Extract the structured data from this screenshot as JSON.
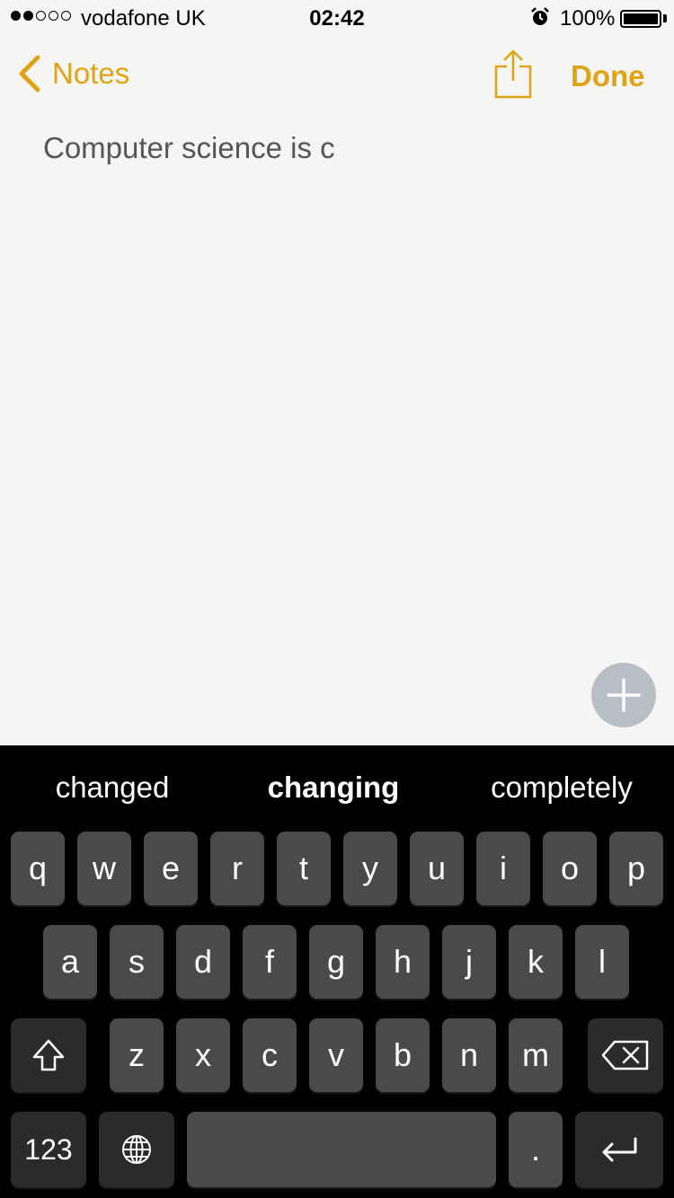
{
  "status_bar": {
    "signal_dots_filled": 2,
    "signal_dots_total": 5,
    "carrier": "vodafone UK",
    "time": "02:42",
    "battery_percent": "100%"
  },
  "nav": {
    "back_label": "Notes",
    "done_label": "Done",
    "accent_color": "#e0a316"
  },
  "note": {
    "text": "Computer science is c"
  },
  "keyboard": {
    "suggestions": [
      "changed",
      "changing",
      "completely"
    ],
    "row1": [
      "q",
      "w",
      "e",
      "r",
      "t",
      "y",
      "u",
      "i",
      "o",
      "p"
    ],
    "row2": [
      "a",
      "s",
      "d",
      "f",
      "g",
      "h",
      "j",
      "k",
      "l"
    ],
    "row3": [
      "z",
      "x",
      "c",
      "v",
      "b",
      "n",
      "m"
    ],
    "numbers_label": "123",
    "period_label": "."
  }
}
